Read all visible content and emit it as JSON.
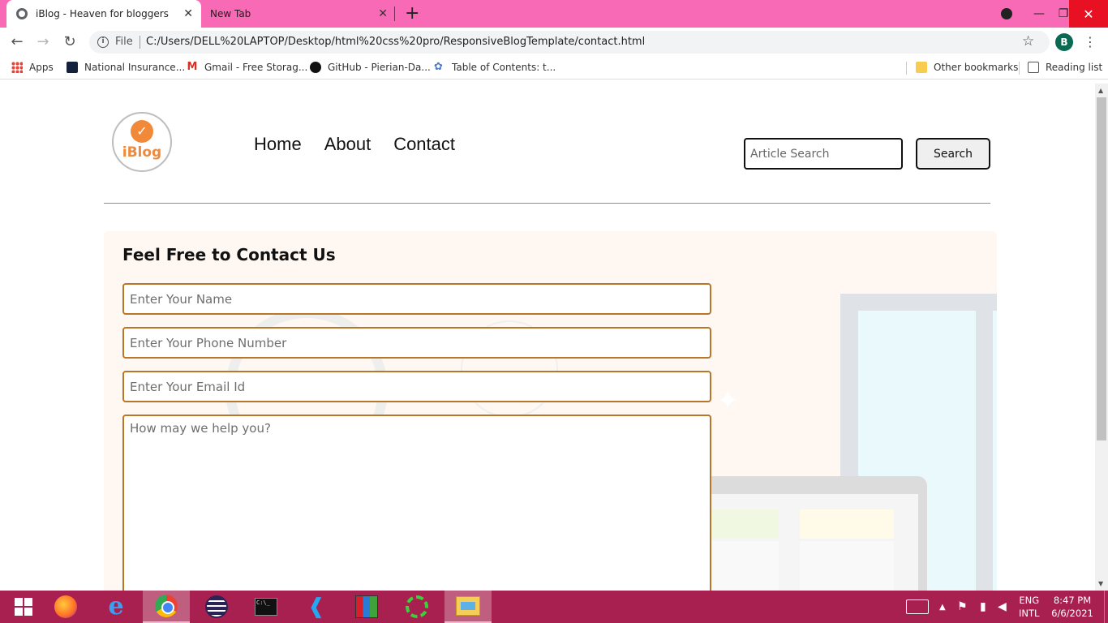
{
  "browser": {
    "tabs": [
      {
        "title": "iBlog - Heaven for bloggers",
        "active": true
      },
      {
        "title": "New Tab",
        "active": false
      }
    ],
    "tab_close_glyph": "✕",
    "new_tab_glyph": "+",
    "window_controls": {
      "minimize": "—",
      "maximize": "❐",
      "close": "✕"
    },
    "omnibox": {
      "scheme_label": "File",
      "url": "C:/Users/DELL%20LAPTOP/Desktop/html%20css%20pro/ResponsiveBlogTemplate/contact.html"
    },
    "profile_initial": "B",
    "bookmarks": [
      {
        "label": "Apps",
        "icon": "apps-grid-icon"
      },
      {
        "label": "National Insurance...",
        "icon": "national-insurance-icon"
      },
      {
        "label": "Gmail - Free Storag...",
        "icon": "gmail-icon"
      },
      {
        "label": "GitHub - Pierian-Da...",
        "icon": "github-icon"
      },
      {
        "label": "Table of Contents: t...",
        "icon": "table-of-contents-icon"
      }
    ],
    "other_bookmarks": "Other bookmarks",
    "reading_list": "Reading list",
    "accent_color": "#f86ab5"
  },
  "site": {
    "logo_text": "iBlog",
    "nav": [
      {
        "label": "Home"
      },
      {
        "label": "About"
      },
      {
        "label": "Contact"
      }
    ],
    "search": {
      "placeholder": "Article Search",
      "button": "Search"
    },
    "contact": {
      "title": "Feel Free to Contact Us",
      "fields": {
        "name_placeholder": "Enter Your Name",
        "phone_placeholder": "Enter Your Phone Number",
        "email_placeholder": "Enter Your Email Id",
        "message_placeholder": "How may we help you?"
      }
    },
    "colors": {
      "field_border": "#b8762a",
      "section_bg": "#fff7f2",
      "logo": "#f08a3a"
    }
  },
  "taskbar": {
    "apps": [
      {
        "name": "start",
        "icon": "windows-start-icon"
      },
      {
        "name": "firefox",
        "icon": "firefox-icon"
      },
      {
        "name": "internet-explorer",
        "icon": "internet-explorer-icon"
      },
      {
        "name": "chrome",
        "icon": "chrome-icon",
        "active": true
      },
      {
        "name": "eclipse",
        "icon": "eclipse-icon"
      },
      {
        "name": "command-prompt",
        "icon": "command-prompt-icon"
      },
      {
        "name": "vscode",
        "icon": "vscode-icon"
      },
      {
        "name": "winrar",
        "icon": "winrar-icon"
      },
      {
        "name": "ring-app",
        "icon": "green-ring-icon"
      },
      {
        "name": "file-explorer",
        "icon": "file-explorer-icon",
        "active": true
      }
    ],
    "language": {
      "line1": "ENG",
      "line2": "INTL"
    },
    "clock": {
      "time": "8:47 PM",
      "date": "6/6/2021"
    },
    "color": "#a8204f"
  }
}
